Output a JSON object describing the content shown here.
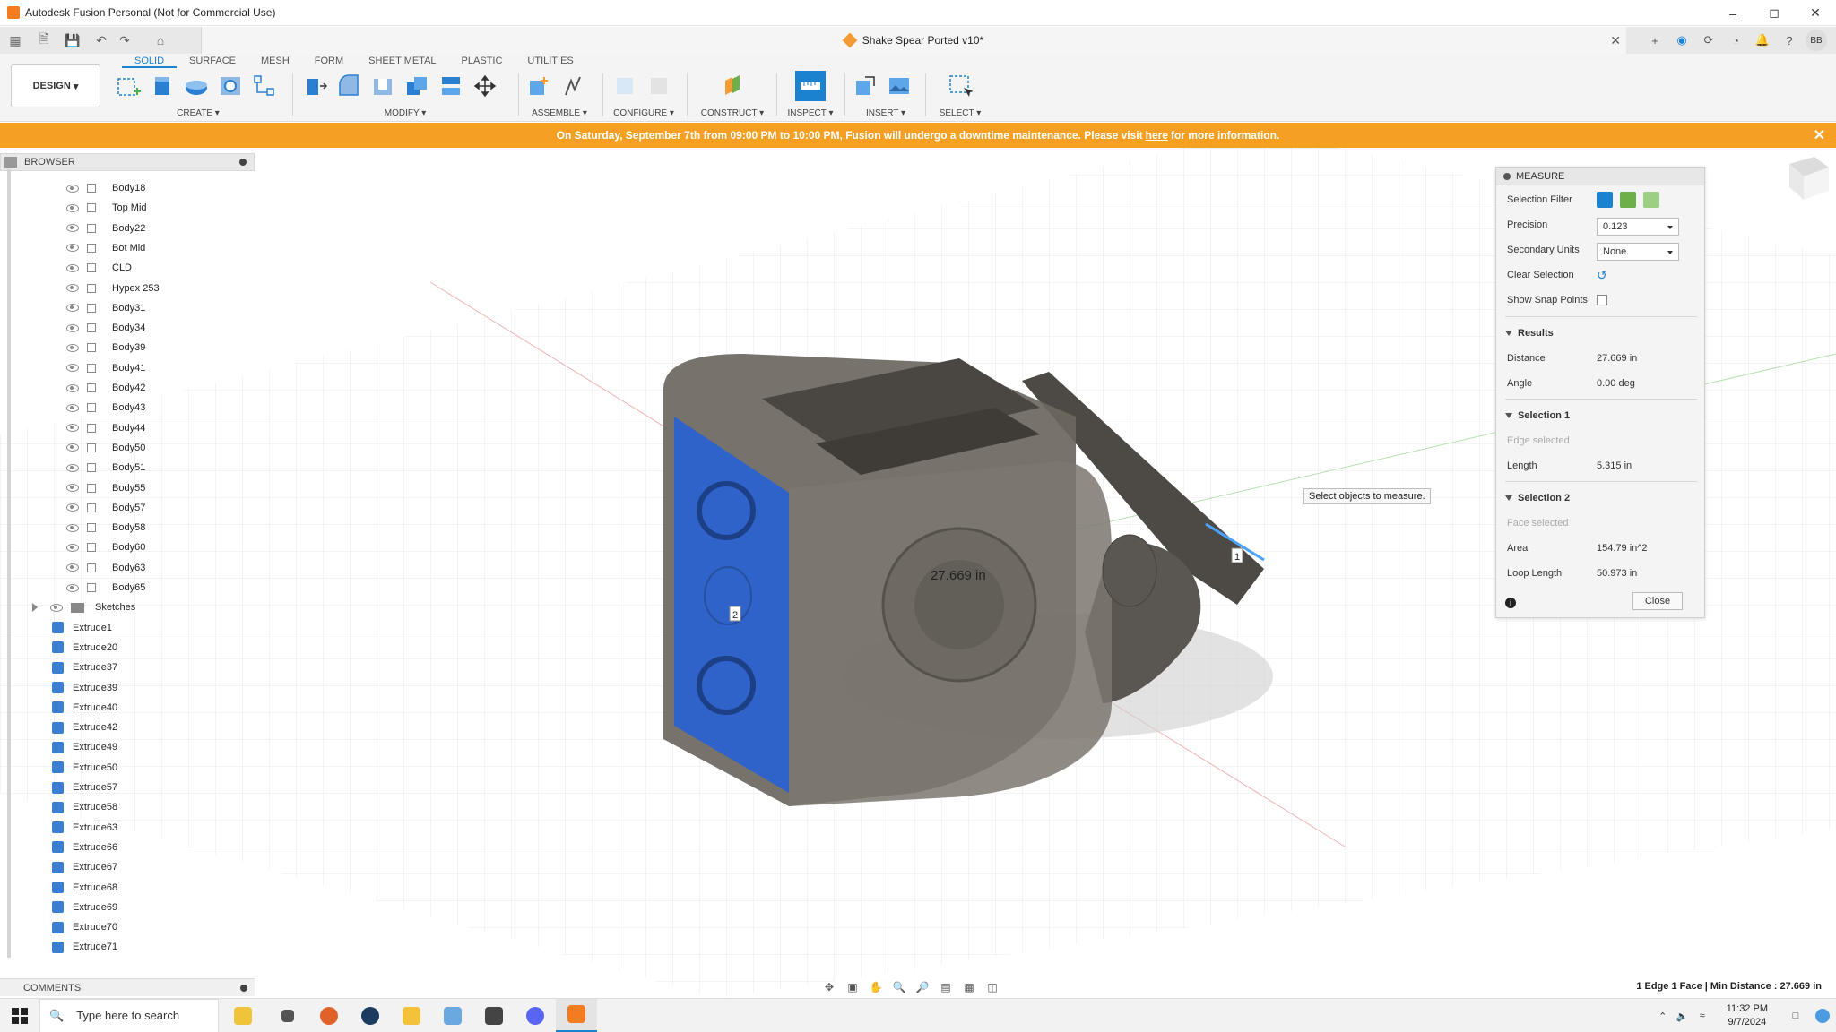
{
  "window": {
    "title": "Autodesk Fusion Personal (Not for Commercial Use)",
    "controls": [
      "minimize-icon",
      "maximize-icon",
      "close-icon"
    ]
  },
  "document": {
    "title": "Shake Spear Ported v10*"
  },
  "ribbon": {
    "workspace": "DESIGN",
    "tabs": [
      "SOLID",
      "SURFACE",
      "MESH",
      "FORM",
      "SHEET METAL",
      "PLASTIC",
      "UTILITIES"
    ],
    "active_tab": "SOLID",
    "groups": [
      "CREATE",
      "MODIFY",
      "ASSEMBLE",
      "CONFIGURE",
      "CONSTRUCT",
      "INSPECT",
      "INSERT",
      "SELECT"
    ]
  },
  "banner": {
    "text_before": "On Saturday, September 7th from 09:00 PM to 10:00 PM, Fusion will undergo a downtime maintenance. Please visit",
    "link": "here",
    "text_after": "for more information.",
    "color": "#f5a023"
  },
  "browser": {
    "title": "BROWSER",
    "bodies": [
      "Body18",
      "Top Mid",
      "Body22",
      "Bot Mid",
      "CLD",
      "Hypex 253",
      "Body31",
      "Body34",
      "Body39",
      "Body41",
      "Body42",
      "Body43",
      "Body44",
      "Body50",
      "Body51",
      "Body55",
      "Body57",
      "Body58",
      "Body60",
      "Body63",
      "Body65"
    ],
    "sketches": "Sketches",
    "features": [
      "Extrude1",
      "Extrude20",
      "Extrude37",
      "Extrude39",
      "Extrude40",
      "Extrude42",
      "Extrude49",
      "Extrude50",
      "Extrude57",
      "Extrude58",
      "Extrude63",
      "Extrude66",
      "Extrude67",
      "Extrude68",
      "Extrude69",
      "Extrude70",
      "Extrude71"
    ]
  },
  "comments": {
    "title": "COMMENTS"
  },
  "viewport": {
    "distance_label": "27.669 in",
    "marker1": "1",
    "marker2": "2",
    "tooltip": "Select objects to measure.",
    "face_color": "#2f63c9"
  },
  "measure": {
    "title": "MEASURE",
    "selection_filter_label": "Selection Filter",
    "precision_label": "Precision",
    "precision_value": "0.123",
    "secondary_units_label": "Secondary Units",
    "secondary_units_value": "None",
    "clear_selection_label": "Clear Selection",
    "show_snap_points_label": "Show Snap Points",
    "results_title": "Results",
    "distance_label": "Distance",
    "distance_value": "27.669 in",
    "angle_label": "Angle",
    "angle_value": "0.00 deg",
    "selection1_title": "Selection 1",
    "selection1_status": "Edge selected",
    "length_label": "Length",
    "length_value": "5.315 in",
    "selection2_title": "Selection 2",
    "selection2_status": "Face selected",
    "area_label": "Area",
    "area_value": "154.79 in^2",
    "loop_length_label": "Loop Length",
    "loop_length_value": "50.973 in",
    "close_label": "Close"
  },
  "status": {
    "text": "1 Edge 1 Face | Min Distance : 27.669 in"
  },
  "taskbar": {
    "search_placeholder": "Type here to search",
    "time": "11:32 PM",
    "date": "9/7/2024"
  }
}
